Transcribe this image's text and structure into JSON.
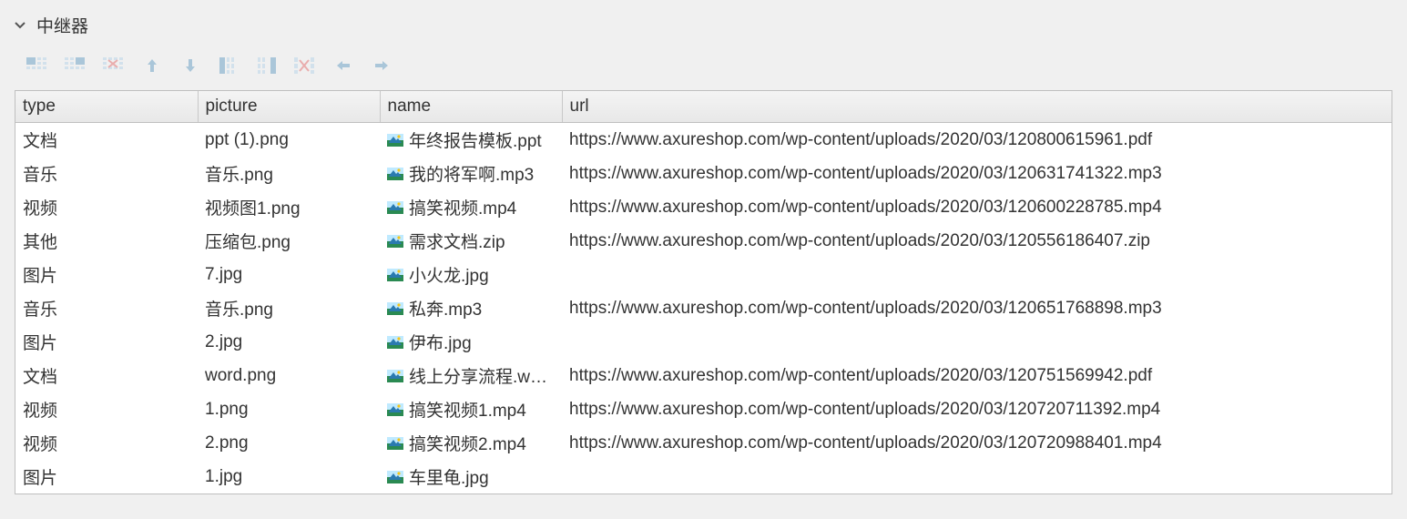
{
  "panel": {
    "title": "中继器"
  },
  "columns": {
    "type": "type",
    "picture": "picture",
    "name": "name",
    "url": "url"
  },
  "rows": [
    {
      "type": "文档",
      "picture": "ppt (1).png",
      "name": "年终报告模板.ppt",
      "url": "https://www.axureshop.com/wp-content/uploads/2020/03/120800615961.pdf"
    },
    {
      "type": "音乐",
      "picture": "音乐.png",
      "name": "我的将军啊.mp3",
      "url": "https://www.axureshop.com/wp-content/uploads/2020/03/120631741322.mp3"
    },
    {
      "type": "视频",
      "picture": "视频图1.png",
      "name": "搞笑视频.mp4",
      "url": "https://www.axureshop.com/wp-content/uploads/2020/03/120600228785.mp4"
    },
    {
      "type": "其他",
      "picture": "压缩包.png",
      "name": "需求文档.zip",
      "url": "https://www.axureshop.com/wp-content/uploads/2020/03/120556186407.zip"
    },
    {
      "type": "图片",
      "picture": "7.jpg",
      "name": "小火龙.jpg",
      "url": ""
    },
    {
      "type": "音乐",
      "picture": "音乐.png",
      "name": "私奔.mp3",
      "url": "https://www.axureshop.com/wp-content/uploads/2020/03/120651768898.mp3"
    },
    {
      "type": "图片",
      "picture": "2.jpg",
      "name": "伊布.jpg",
      "url": ""
    },
    {
      "type": "文档",
      "picture": "word.png",
      "name": "线上分享流程.w…",
      "url": "https://www.axureshop.com/wp-content/uploads/2020/03/120751569942.pdf"
    },
    {
      "type": "视频",
      "picture": "1.png",
      "name": "搞笑视频1.mp4",
      "url": "https://www.axureshop.com/wp-content/uploads/2020/03/120720711392.mp4"
    },
    {
      "type": "视频",
      "picture": "2.png",
      "name": "搞笑视频2.mp4",
      "url": "https://www.axureshop.com/wp-content/uploads/2020/03/120720988401.mp4"
    },
    {
      "type": "图片",
      "picture": "1.jpg",
      "name": "车里龟.jpg",
      "url": ""
    }
  ]
}
